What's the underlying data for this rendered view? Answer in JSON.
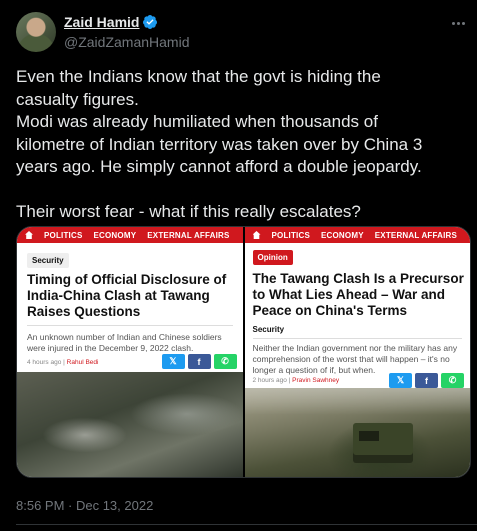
{
  "author": {
    "name": "Zaid Hamid",
    "handle": "@ZaidZamanHamid",
    "verified_icon": "verified-badge-icon",
    "avatar": "profile-photo"
  },
  "tweet": {
    "paragraph1": "Even the Indians know that the govt is hiding the\ncasualty figures.\nModi was already humiliated when thousands of\nkilometre of Indian territory was taken over by China 3\nyears ago. He simply cannot afford a double jeopardy.",
    "paragraph2": "Their worst fear - what if this really escalates?",
    "timestamp": "8:56 PM · Dec 13, 2022"
  },
  "cards": [
    {
      "nav": [
        "POLITICS",
        "ECONOMY",
        "EXTERNAL AFFAIRS"
      ],
      "category": "Security",
      "headline": "Timing of Official Disclosure of India-China Clash at Tawang Raises Questions",
      "summary": "An unknown number of Indian and Chinese soldiers were injured in the December 9, 2022 clash.",
      "time": "4 hours ago",
      "author": "Rahul Bedi"
    },
    {
      "nav": [
        "POLITICS",
        "ECONOMY",
        "EXTERNAL AFFAIRS"
      ],
      "tag": "Opinion",
      "headline": "The Tawang Clash Is a Precursor to What Lies Ahead – War and Peace on China's Terms",
      "category": "Security",
      "summary": "Neither the Indian government nor the military has any comprehension of the worst that will happen – it's no longer a question of if, but when.",
      "time": "2 hours ago",
      "author": "Pravin Sawhney"
    }
  ],
  "share": {
    "twitter": "𝕏",
    "facebook": "f",
    "whatsapp": "✆"
  },
  "colors": {
    "accent": "#1d9bf0",
    "brand_red": "#d0181e",
    "background": "#000000",
    "muted": "#71767b"
  }
}
